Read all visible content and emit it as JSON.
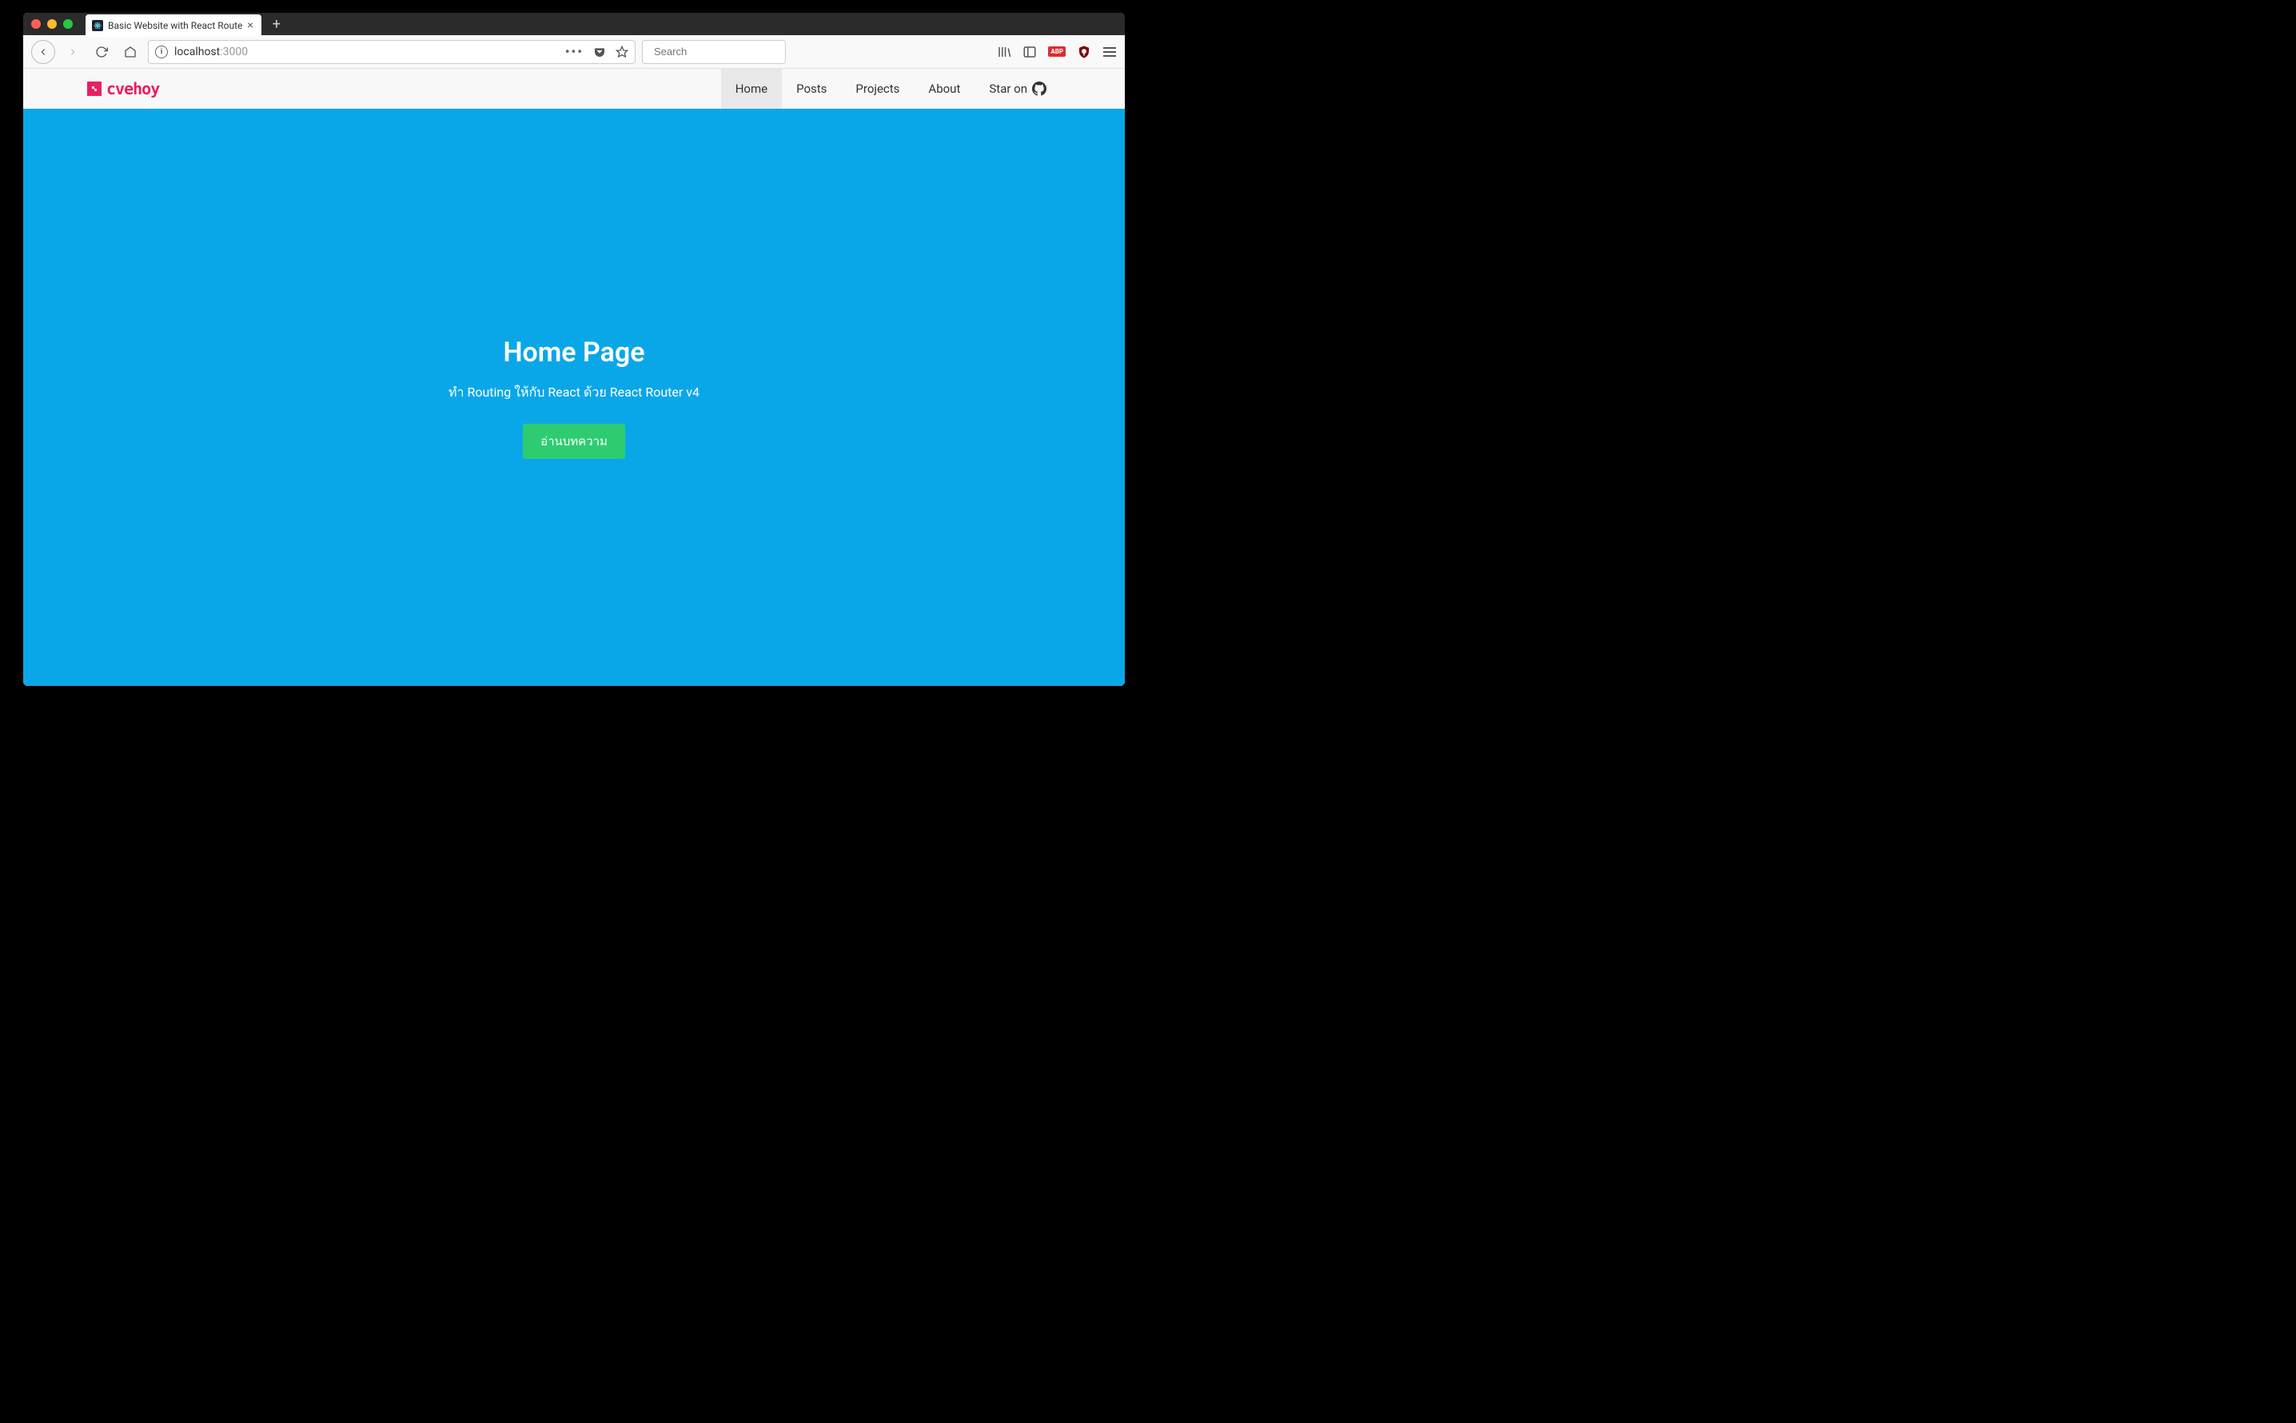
{
  "browser": {
    "tab_title": "Basic Website with React Route",
    "url_host": "localhost",
    "url_port": ":3000",
    "search_placeholder": "Search"
  },
  "toolbar_ext": {
    "abp": "ABP"
  },
  "site": {
    "logo_text": "cvehoy",
    "nav": {
      "home": "Home",
      "posts": "Posts",
      "projects": "Projects",
      "about": "About",
      "star": "Star on"
    }
  },
  "hero": {
    "title": "Home Page",
    "subtitle": "ทำ Routing ให้กับ React ด้วย React Router v4",
    "cta": "อ่านบทความ"
  }
}
